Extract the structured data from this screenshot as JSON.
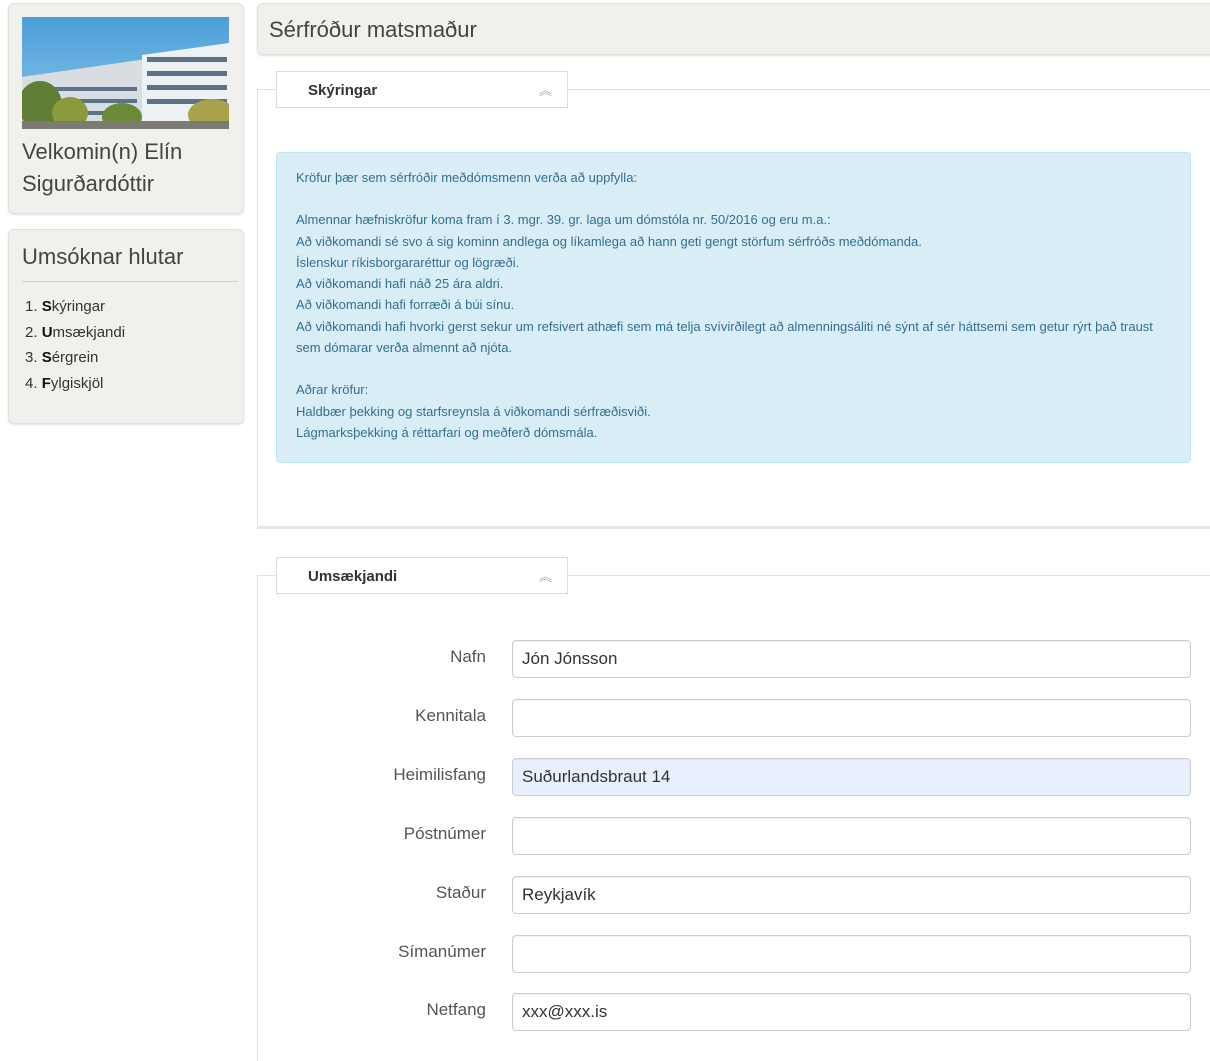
{
  "sidebar": {
    "welcome": "Velkomin(n) Elín Sigurðardóttir",
    "nav_title": "Umsóknar hlutar",
    "nav_items": [
      {
        "num": "1.",
        "initial": "S",
        "rest": "kýringar"
      },
      {
        "num": "2.",
        "initial": "U",
        "rest": "msækjandi"
      },
      {
        "num": "3.",
        "initial": "S",
        "rest": "érgrein"
      },
      {
        "num": "4.",
        "initial": "F",
        "rest": "ylgiskjöl"
      }
    ]
  },
  "header": {
    "title": "Sérfróður matsmaður"
  },
  "sections": {
    "explanations": {
      "tab_label": "Skýringar",
      "info_lines": [
        "Kröfur þær sem sérfróðir meðdómsmenn verða að uppfylla:",
        "",
        "Almennar hæfniskröfur koma fram í 3. mgr. 39. gr. laga um dómstóla nr. 50/2016 og eru m.a.:",
        "Að viðkomandi sé svo á sig kominn andlega og líkamlega að hann geti gengt störfum sérfróðs meðdómanda.",
        "Íslenskur ríkisborgararéttur og lögræði.",
        "Að viðkomandi hafi náð 25 ára aldri.",
        "Að viðkomandi hafi forræði á búi sínu.",
        "Að viðkomandi hafi hvorki gerst sekur um refsivert athæfi sem má telja svívirðilegt að almenningsáliti né sýnt af sér háttsemi sem getur rýrt það traust sem dómarar verða almennt að njóta.",
        "",
        "Aðrar kröfur:",
        "Haldbær þekking og starfsreynsla á viðkomandi sérfræðisviði.",
        "Lágmarksþekking á réttarfari og meðferð dómsmála."
      ]
    },
    "applicant": {
      "tab_label": "Umsækjandi",
      "fields": [
        {
          "label": "Nafn",
          "value": "Jón Jónsson"
        },
        {
          "label": "Kennitala",
          "value": ""
        },
        {
          "label": "Heimilisfang",
          "value": "Suðurlandsbraut 14"
        },
        {
          "label": "Póstnúmer",
          "value": ""
        },
        {
          "label": "Staður",
          "value": "Reykjavík"
        },
        {
          "label": "Símanúmer",
          "value": ""
        },
        {
          "label": "Netfang",
          "value": "xxx@xxx.is"
        }
      ]
    }
  },
  "colors": {
    "panel_bg": "#f1f0ed",
    "info_bg": "#d9edf7",
    "info_text": "#31708f",
    "autofill_bg": "#e8f0fe"
  },
  "icons": {
    "collapse": "chevron-up-double-icon"
  }
}
